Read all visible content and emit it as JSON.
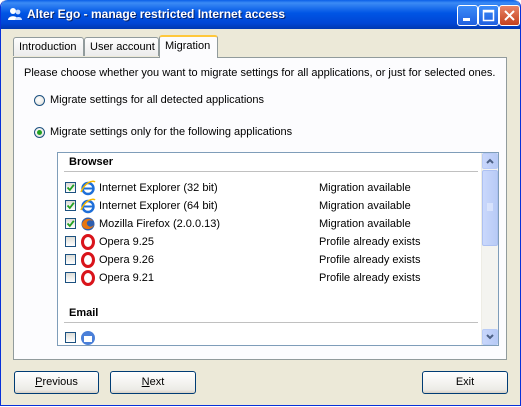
{
  "window": {
    "title": "Alter Ego - manage restricted Internet access"
  },
  "tabs": [
    {
      "label": "Introduction"
    },
    {
      "label": "User account"
    },
    {
      "label": "Migration"
    }
  ],
  "migration": {
    "intro": "Please choose whether you want to migrate settings for all applications, or just for selected ones.",
    "option_all": "Migrate settings for all detected applications",
    "option_selected": "Migrate settings only for the following applications",
    "selected_option": "option_selected"
  },
  "groups": {
    "browser": "Browser",
    "email": "Email"
  },
  "apps": [
    {
      "name": "Internet Explorer (32 bit)",
      "status": "Migration available",
      "checked": true,
      "icon": "internet-explorer-icon"
    },
    {
      "name": "Internet Explorer (64 bit)",
      "status": "Migration available",
      "checked": true,
      "icon": "internet-explorer-icon"
    },
    {
      "name": "Mozilla Firefox (2.0.0.13)",
      "status": "Migration available",
      "checked": true,
      "icon": "firefox-icon"
    },
    {
      "name": "Opera 9.25",
      "status": "Profile already exists",
      "checked": false,
      "icon": "opera-icon"
    },
    {
      "name": "Opera 9.26",
      "status": "Profile already exists",
      "checked": false,
      "icon": "opera-icon"
    },
    {
      "name": "Opera 9.21",
      "status": "Profile already exists",
      "checked": false,
      "icon": "opera-icon"
    }
  ],
  "buttons": {
    "previous": {
      "accel": "P",
      "rest": "revious"
    },
    "next": {
      "accel": "N",
      "rest": "ext"
    },
    "exit": "Exit"
  },
  "colors": {
    "accent": "#0055e5",
    "tab_highlight": "#ffc83c",
    "radio_dot": "#21a121"
  }
}
